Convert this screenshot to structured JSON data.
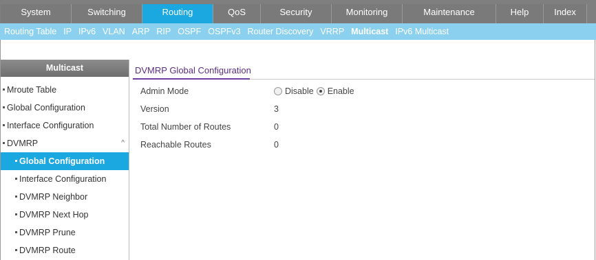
{
  "topnav": [
    {
      "label": "System",
      "active": false
    },
    {
      "label": "Switching",
      "active": false
    },
    {
      "label": "Routing",
      "active": true
    },
    {
      "label": "QoS",
      "active": false
    },
    {
      "label": "Security",
      "active": false
    },
    {
      "label": "Monitoring",
      "active": false
    },
    {
      "label": "Maintenance",
      "active": false
    },
    {
      "label": "Help",
      "active": false
    },
    {
      "label": "Index",
      "active": false
    }
  ],
  "subnav": [
    {
      "label": "Routing Table",
      "active": false
    },
    {
      "label": "IP",
      "active": false
    },
    {
      "label": "IPv6",
      "active": false
    },
    {
      "label": "VLAN",
      "active": false
    },
    {
      "label": "ARP",
      "active": false
    },
    {
      "label": "RIP",
      "active": false
    },
    {
      "label": "OSPF",
      "active": false
    },
    {
      "label": "OSPFv3",
      "active": false
    },
    {
      "label": "Router Discovery",
      "active": false
    },
    {
      "label": "VRRP",
      "active": false
    },
    {
      "label": "Multicast",
      "active": true
    },
    {
      "label": "IPv6 Multicast",
      "active": false
    }
  ],
  "sidebar": {
    "header": "Multicast",
    "items": [
      {
        "label": "Mroute Table"
      },
      {
        "label": "Global Configuration"
      },
      {
        "label": "Interface Configuration"
      },
      {
        "label": "DVMRP",
        "caret": "^"
      },
      {
        "label": "Global Configuration"
      },
      {
        "label": "Interface Configuration"
      },
      {
        "label": "DVMRP Neighbor"
      },
      {
        "label": "DVMRP Next Hop"
      },
      {
        "label": "DVMRP Prune"
      },
      {
        "label": "DVMRP Route"
      }
    ]
  },
  "main": {
    "title": "DVMRP Global Configuration",
    "admin_mode": {
      "label": "Admin Mode",
      "options": [
        "Disable",
        "Enable"
      ],
      "selected": "Enable"
    },
    "version": {
      "label": "Version",
      "value": "3"
    },
    "total_routes": {
      "label": "Total Number of Routes",
      "value": "0"
    },
    "reachable_routes": {
      "label": "Reachable Routes",
      "value": "0"
    }
  }
}
